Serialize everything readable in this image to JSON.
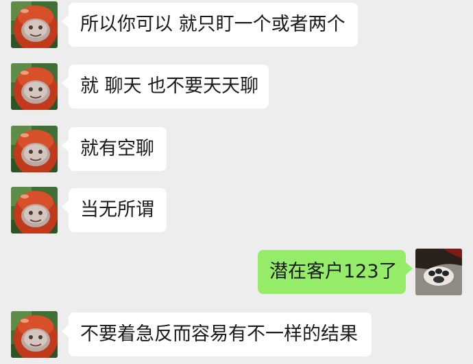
{
  "chat": {
    "messages": [
      {
        "side": "in",
        "text": "所以你可以 就只盯一个或者两个",
        "avatar": "red-teletubby-avatar"
      },
      {
        "side": "in",
        "text": "就 聊天 也不要天天聊",
        "avatar": "red-teletubby-avatar"
      },
      {
        "side": "in",
        "text": "就有空聊",
        "avatar": "red-teletubby-avatar"
      },
      {
        "side": "in",
        "text": "当无所谓",
        "avatar": "red-teletubby-avatar"
      },
      {
        "side": "out",
        "text": "潜在客户123了",
        "avatar": "cat-paw-avatar"
      },
      {
        "side": "in",
        "text": "不要着急反而容易有不一样的结果",
        "avatar": "red-teletubby-avatar"
      }
    ]
  },
  "colors": {
    "background": "#ededed",
    "incoming_bubble": "#ffffff",
    "outgoing_bubble": "#95ec69"
  }
}
